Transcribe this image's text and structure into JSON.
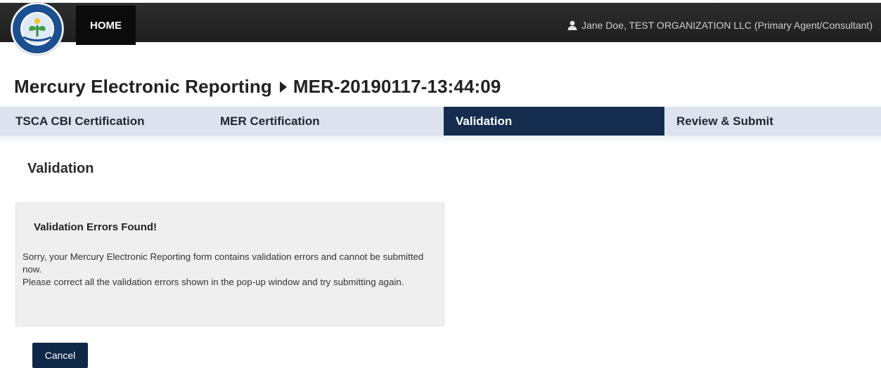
{
  "header": {
    "home_label": "HOME",
    "logo_icon": "epa-seal-icon",
    "user_icon": "user-icon",
    "user_text": "Jane Doe, TEST ORGANIZATION LLC (Primary Agent/Consultant)"
  },
  "page": {
    "title_prefix": "Mercury Electronic Reporting",
    "title_separator_icon": "caret-right-icon",
    "title_record": "MER-20190117-13:44:09"
  },
  "steps": [
    {
      "label": "TSCA CBI Certification",
      "active": false
    },
    {
      "label": "MER Certification",
      "active": false
    },
    {
      "label": "Validation",
      "active": true
    },
    {
      "label": "Review & Submit",
      "active": false
    }
  ],
  "main": {
    "heading": "Validation",
    "error_title": "Validation Errors Found!",
    "error_line1": "Sorry, your Mercury Electronic Reporting form contains validation errors and cannot be submitted now.",
    "error_line2": "Please correct all the validation errors shown in the pop-up window and try submitting again.",
    "cancel_label": "Cancel"
  },
  "colors": {
    "topbar": "#262626",
    "steps_bg": "#dce3ee",
    "active_step": "#142d4f",
    "button": "#0f2847",
    "panel": "#efefef"
  }
}
